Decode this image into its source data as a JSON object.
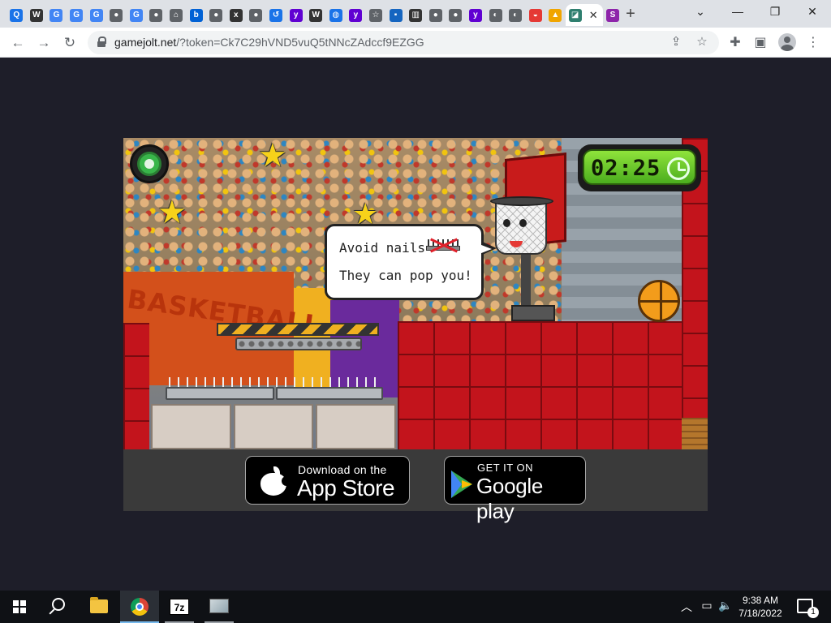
{
  "browser": {
    "tabs": [
      {
        "icon": "search-icon",
        "glyph": "Q",
        "color": "#1a73e8"
      },
      {
        "icon": "wikipedia-icon",
        "glyph": "W",
        "color": "#333333"
      },
      {
        "icon": "google-icon",
        "glyph": "G",
        "color": "#4285f4"
      },
      {
        "icon": "google-icon",
        "glyph": "G",
        "color": "#4285f4"
      },
      {
        "icon": "google-icon",
        "glyph": "G",
        "color": "#4285f4"
      },
      {
        "icon": "globe-icon",
        "glyph": "●",
        "color": "#5f6368"
      },
      {
        "icon": "google-icon",
        "glyph": "G",
        "color": "#4285f4"
      },
      {
        "icon": "globe-icon",
        "glyph": "●",
        "color": "#5f6368"
      },
      {
        "icon": "home-icon",
        "glyph": "⌂",
        "color": "#5f6368"
      },
      {
        "icon": "box-icon",
        "glyph": "b",
        "color": "#0061d5"
      },
      {
        "icon": "globe-icon",
        "glyph": "●",
        "color": "#5f6368"
      },
      {
        "icon": "xfs-icon",
        "glyph": "x",
        "color": "#333333"
      },
      {
        "icon": "globe-icon",
        "glyph": "●",
        "color": "#5f6368"
      },
      {
        "icon": "history-icon",
        "glyph": "↺",
        "color": "#1a73e8"
      },
      {
        "icon": "yahoo-icon",
        "glyph": "y",
        "color": "#6001d2"
      },
      {
        "icon": "wikipedia-icon",
        "glyph": "W",
        "color": "#333333"
      },
      {
        "icon": "web-icon",
        "glyph": "◍",
        "color": "#1a73e8"
      },
      {
        "icon": "yahoo-icon",
        "glyph": "y",
        "color": "#6001d2"
      },
      {
        "icon": "star-icon",
        "glyph": "☆",
        "color": "#5f6368"
      },
      {
        "icon": "photo-icon",
        "glyph": "▪",
        "color": "#1565c0"
      },
      {
        "icon": "museum-icon",
        "glyph": "▥",
        "color": "#333333"
      },
      {
        "icon": "globe-icon",
        "glyph": "●",
        "color": "#5f6368"
      },
      {
        "icon": "globe-icon",
        "glyph": "●",
        "color": "#5f6368"
      },
      {
        "icon": "yahoo-icon",
        "glyph": "y",
        "color": "#6001d2"
      },
      {
        "icon": "game-icon",
        "glyph": "◐",
        "color": "#5f6368"
      },
      {
        "icon": "game-icon",
        "glyph": "◐",
        "color": "#5f6368"
      },
      {
        "icon": "game-icon",
        "glyph": "◒",
        "color": "#e53935"
      },
      {
        "icon": "game-icon",
        "glyph": "▲",
        "color": "#f0a500"
      },
      {
        "icon": "gamejolt-icon",
        "glyph": "◪",
        "color": "#2f7f6f",
        "active": true,
        "close": "✕"
      },
      {
        "icon": "s-icon",
        "glyph": "S",
        "color": "#8e24aa"
      }
    ],
    "new_tab": "+",
    "window_controls": {
      "dropdown": "⌄",
      "minimize": "—",
      "maximize": "❐",
      "close": "✕"
    },
    "url_host": "gamejolt.net",
    "url_rest": "/?token=Ck7C29hVND5vuQ5tNNcZAdccf9EZGG"
  },
  "game": {
    "timer": "02:25",
    "bubble": {
      "line1": "Avoid nails",
      "line2": "They can pop you!"
    },
    "banner_text": "BASKETBALL"
  },
  "stores": {
    "appstore": {
      "small": "Download on the",
      "big": "App Store"
    },
    "googleplay": {
      "small": "GET IT ON",
      "big": "Google play"
    }
  },
  "taskbar": {
    "time": "9:38 AM",
    "date": "7/18/2022",
    "notification_count": "1",
    "sevenzip_label": "7z"
  }
}
